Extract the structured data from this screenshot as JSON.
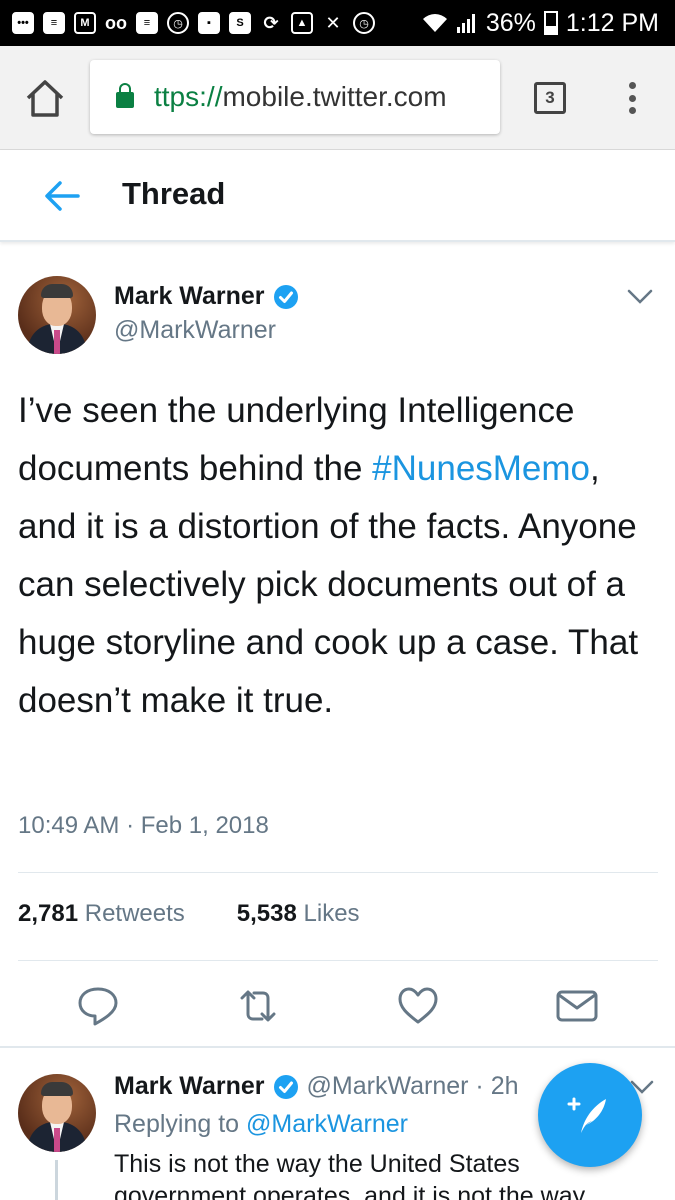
{
  "status_bar": {
    "battery": "36%",
    "time": "1:12 PM",
    "notification_icons": [
      "more-icon",
      "message-icon",
      "gmail-icon",
      "voicemail-icon",
      "message-icon",
      "alarm-icon",
      "chat-icon",
      "app-s-icon",
      "sync-icon",
      "image-icon",
      "mute-icon",
      "alarm-icon",
      "wifi-icon",
      "signal-icon"
    ]
  },
  "browser": {
    "url_scheme": "ttps://",
    "url_host": "mobile.twitter.com",
    "tab_count": "3"
  },
  "header": {
    "title": "Thread"
  },
  "tweet": {
    "author_name": "Mark Warner",
    "author_handle": "@MarkWarner",
    "text_before": "I’ve seen the underlying Intelligence documents behind the ",
    "hashtag": "#NunesMemo",
    "text_after": ", and it is a distortion of the facts. Anyone can selectively pick documents out of a huge storyline and cook up a case. That doesn’t make it true.",
    "timestamp": "10:49 AM · Feb 1, 2018",
    "retweets_count": "2,781",
    "retweets_label": "Retweets",
    "likes_count": "5,538",
    "likes_label": "Likes"
  },
  "reply": {
    "author_name": "Mark Warner",
    "author_meta": "@MarkWarner · 2h",
    "replying_prefix": "Replying to ",
    "replying_to": "@MarkWarner",
    "text": "This is not the way the United States government operates, and it is not the way"
  },
  "colors": {
    "accent": "#1da1f2",
    "link": "#1b95e0",
    "secure": "#0b8043",
    "muted": "#657786"
  }
}
